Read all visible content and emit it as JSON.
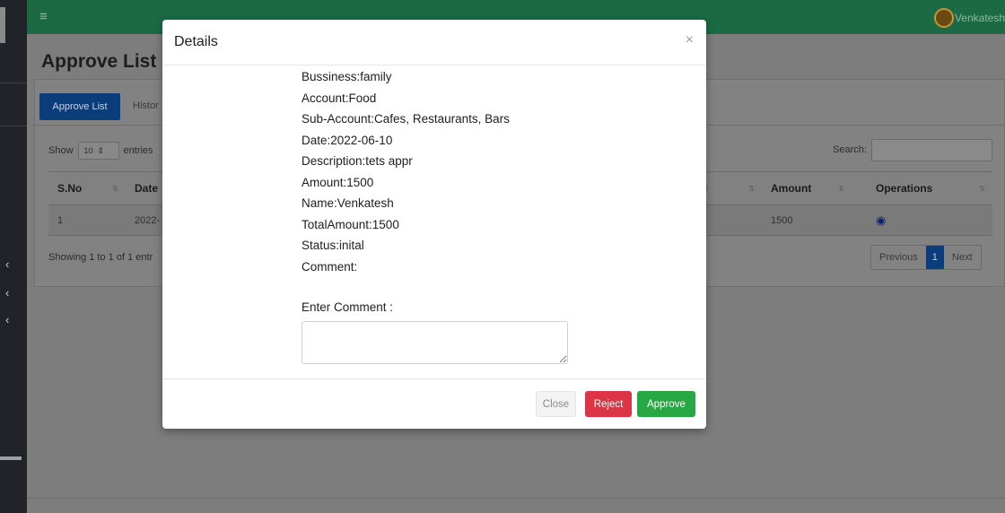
{
  "navbar": {
    "toggle_icon": "bars-icon",
    "user_name": "Venkatesh",
    "color": "#1c6a45"
  },
  "page": {
    "title": "Approve List"
  },
  "tabs": [
    {
      "label": "Approve List"
    },
    {
      "label": "Histor"
    }
  ],
  "table_controls": {
    "show_label": "Show",
    "page_length": "10",
    "entries_label": "entries",
    "search_label": "Search:"
  },
  "table": {
    "headers": [
      "S.No",
      "Date",
      "Amount",
      "Operations"
    ],
    "rows": [
      {
        "sno": "1",
        "date": "2022-",
        "amount": "1500",
        "operation_icon": "eye-icon"
      }
    ]
  },
  "footer_info": {
    "showing": "Showing 1 to 1 of 1 entr"
  },
  "pagination": {
    "previous": "Previous",
    "current": "1",
    "next": "Next"
  },
  "modal": {
    "title": "Details",
    "close_symbol": "×",
    "details": [
      "Bussiness:family",
      "Account:Food",
      "Sub-Account:Cafes, Restaurants, Bars",
      "Date:2022-06-10",
      "Description:tets appr",
      "Amount:1500",
      "Name:Venkatesh",
      "TotalAmount:1500",
      "Status:inital",
      "Comment:"
    ],
    "comment_label": "Enter Comment :",
    "comment_value": "",
    "buttons": {
      "close": "Close",
      "reject": "Reject",
      "approve": "Approve"
    },
    "colors": {
      "reject": "#dc3545",
      "approve": "#28a745"
    }
  }
}
